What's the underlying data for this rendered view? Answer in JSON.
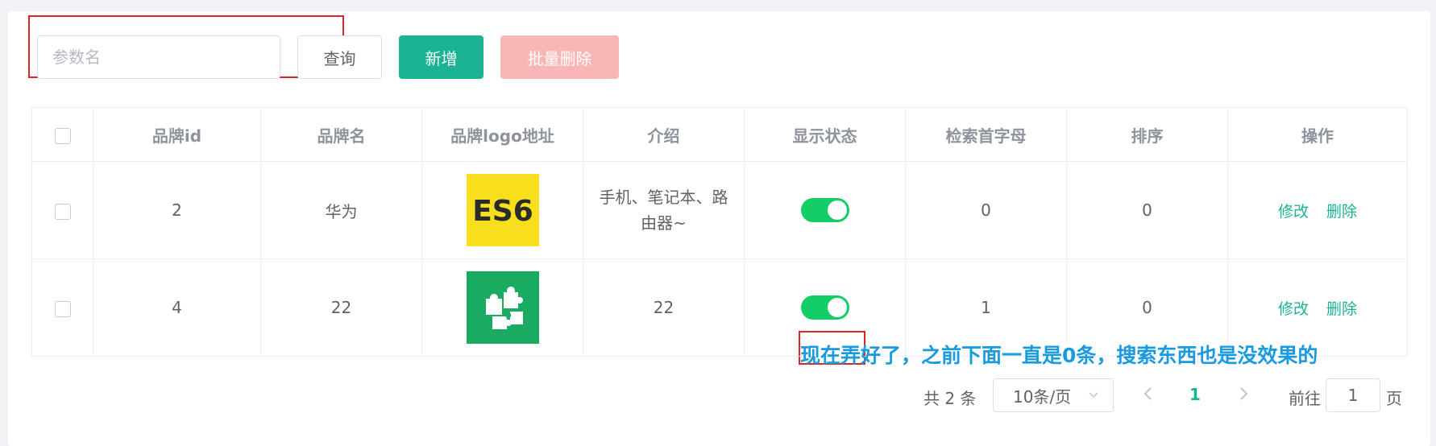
{
  "toolbar": {
    "search_placeholder": "参数名",
    "search_value": "",
    "query_label": "查询",
    "add_label": "新增",
    "bulk_delete_label": "批量删除"
  },
  "table": {
    "columns": [
      "品牌id",
      "品牌名",
      "品牌logo地址",
      "介绍",
      "显示状态",
      "检索首字母",
      "排序",
      "操作"
    ],
    "rows": [
      {
        "id": "2",
        "name": "华为",
        "logo": "ES6",
        "intro": "手机、笔记本、路由器~",
        "show_status": true,
        "first_letter": "0",
        "sort": "0",
        "edit": "修改",
        "delete": "删除"
      },
      {
        "id": "4",
        "name": "22",
        "logo": "puzzle-logo",
        "intro": "22",
        "show_status": true,
        "first_letter": "1",
        "sort": "0",
        "edit": "修改",
        "delete": "删除"
      }
    ]
  },
  "annotation": "现在弄好了，之前下面一直是0条，搜索东西也是没效果的",
  "pagination": {
    "total": "共 2 条",
    "page_size": "10条/页",
    "current_page": "1",
    "goto_label": "前往",
    "goto_value": "1",
    "page_unit": "页"
  },
  "colors": {
    "primary": "#1bb394",
    "danger_disabled": "#fab6b6",
    "switch_on": "#13ce66",
    "highlight": "#e02424",
    "annotation": "#1a9be0"
  }
}
